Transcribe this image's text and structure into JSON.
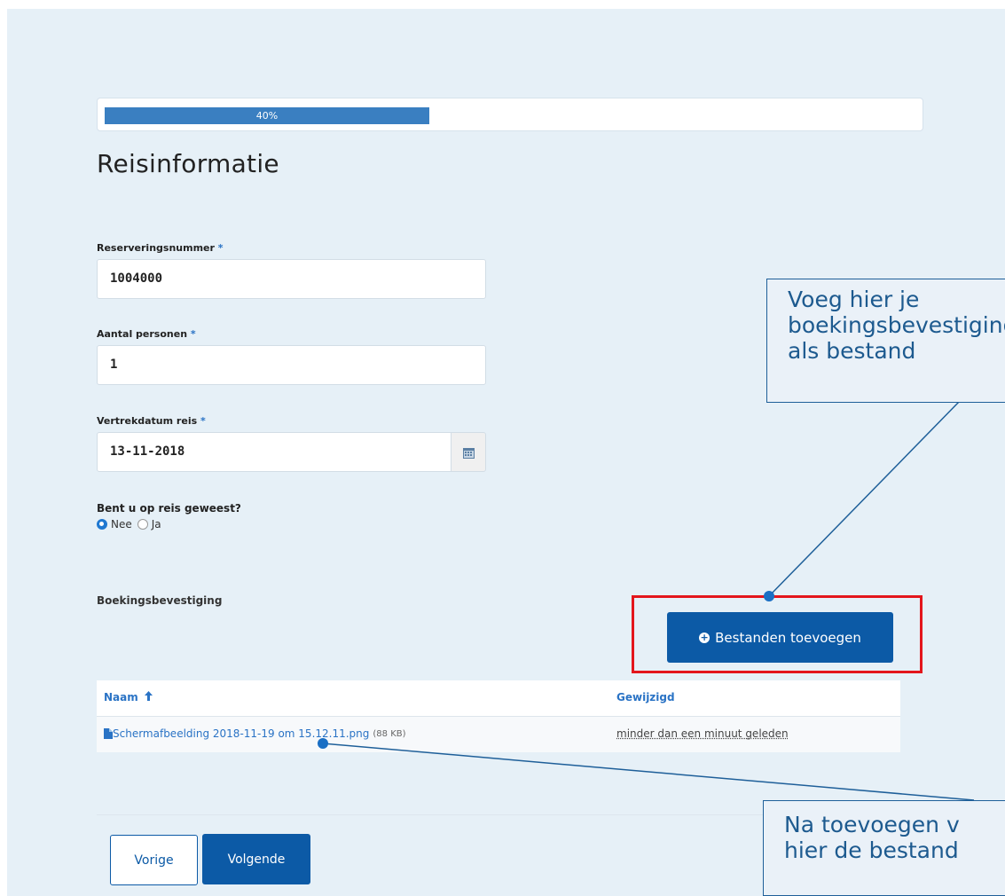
{
  "progress": {
    "label": "40%",
    "value": 0.4
  },
  "form": {
    "title": "Reisinformatie",
    "required_mark": "*",
    "reservation": {
      "label": "Reserveringsnummer",
      "value": "1004000"
    },
    "persons": {
      "label": "Aantal personen",
      "value": "1"
    },
    "departure": {
      "label": "Vertrekdatum reis",
      "value": "13-11-2018"
    },
    "traveled": {
      "question": "Bent u op reis geweest?",
      "options": [
        {
          "label": "Nee",
          "selected": true
        },
        {
          "label": "Ja",
          "selected": false
        }
      ]
    },
    "booking_section": "Boekingsbevestiging",
    "add_files_button": "Bestanden toevoegen"
  },
  "files": {
    "headers": {
      "name": "Naam",
      "sort_icon": "arrow-up-icon",
      "modified": "Gewijzigd"
    },
    "rows": [
      {
        "name": "Schermafbeelding 2018-11-19 om 15.12.11.png",
        "size": "(88 KB)",
        "modified": "minder dan een minuut geleden"
      }
    ]
  },
  "nav": {
    "prev": "Vorige",
    "next": "Volgende"
  },
  "callouts": {
    "top": [
      "Voeg hier je",
      "boekingsbevestiging",
      "als bestand"
    ],
    "bottom": [
      "Na toevoegen v",
      "hier de bestand"
    ]
  },
  "colors": {
    "accent": "#0c5aa6",
    "highlight": "#e3161c",
    "link": "#2a73c5"
  }
}
